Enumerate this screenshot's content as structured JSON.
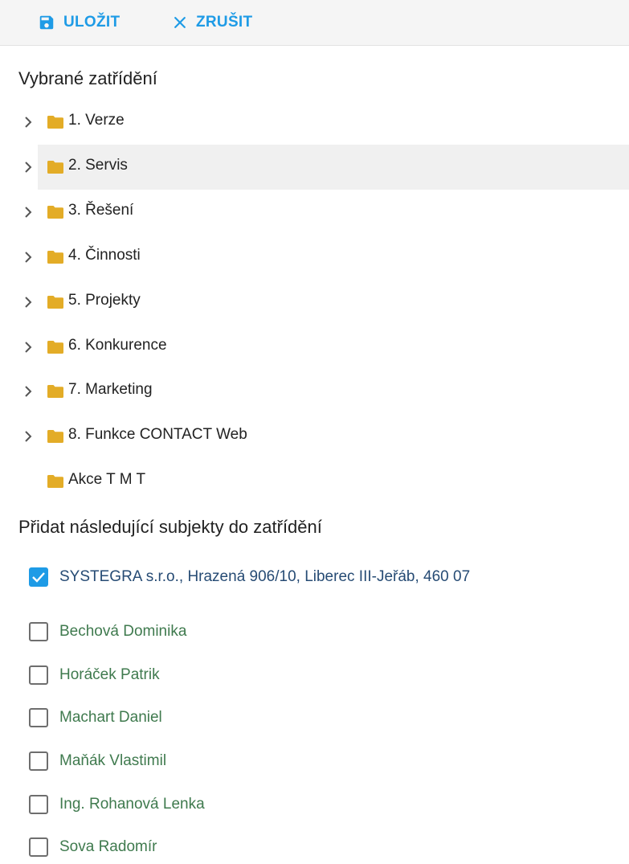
{
  "toolbar": {
    "save_label": "ULOŽIT",
    "cancel_label": "ZRUŠIT",
    "save_icon": "floppy-disk-icon",
    "cancel_icon": "close-icon"
  },
  "sections": {
    "selected_title": "Vybrané zatřídění",
    "add_title": "Přidat následující subjekty do zatřídění"
  },
  "tree": {
    "items": [
      {
        "label": "1. Verze",
        "expandable": true,
        "highlighted": false
      },
      {
        "label": "2. Servis",
        "expandable": true,
        "highlighted": true
      },
      {
        "label": "3. Řešení",
        "expandable": true,
        "highlighted": false
      },
      {
        "label": "4. Činnosti",
        "expandable": true,
        "highlighted": false
      },
      {
        "label": "5. Projekty",
        "expandable": true,
        "highlighted": false
      },
      {
        "label": "6. Konkurence",
        "expandable": true,
        "highlighted": false
      },
      {
        "label": "7. Marketing",
        "expandable": true,
        "highlighted": false
      },
      {
        "label": "8. Funkce CONTACT Web",
        "expandable": true,
        "highlighted": false
      },
      {
        "label": "Akce T M T",
        "expandable": false,
        "highlighted": false
      }
    ]
  },
  "subjects": [
    {
      "label": "SYSTEGRA s.r.o., Hrazená 906/10, Liberec III-Jeřáb, 460 07",
      "checked": true,
      "kind": "company"
    },
    {
      "label": "Bechová Dominika",
      "checked": false,
      "kind": "person"
    },
    {
      "label": "Horáček Patrik",
      "checked": false,
      "kind": "person"
    },
    {
      "label": "Machart Daniel",
      "checked": false,
      "kind": "person"
    },
    {
      "label": "Maňák Vlastimil",
      "checked": false,
      "kind": "person"
    },
    {
      "label": "Ing. Rohanová Lenka",
      "checked": false,
      "kind": "person"
    },
    {
      "label": "Sova Radomír",
      "checked": false,
      "kind": "person"
    }
  ],
  "colors": {
    "accent": "#1e9be6",
    "folder": "#e3ac27",
    "company_text": "#264b74",
    "person_text": "#3f7a4e"
  }
}
